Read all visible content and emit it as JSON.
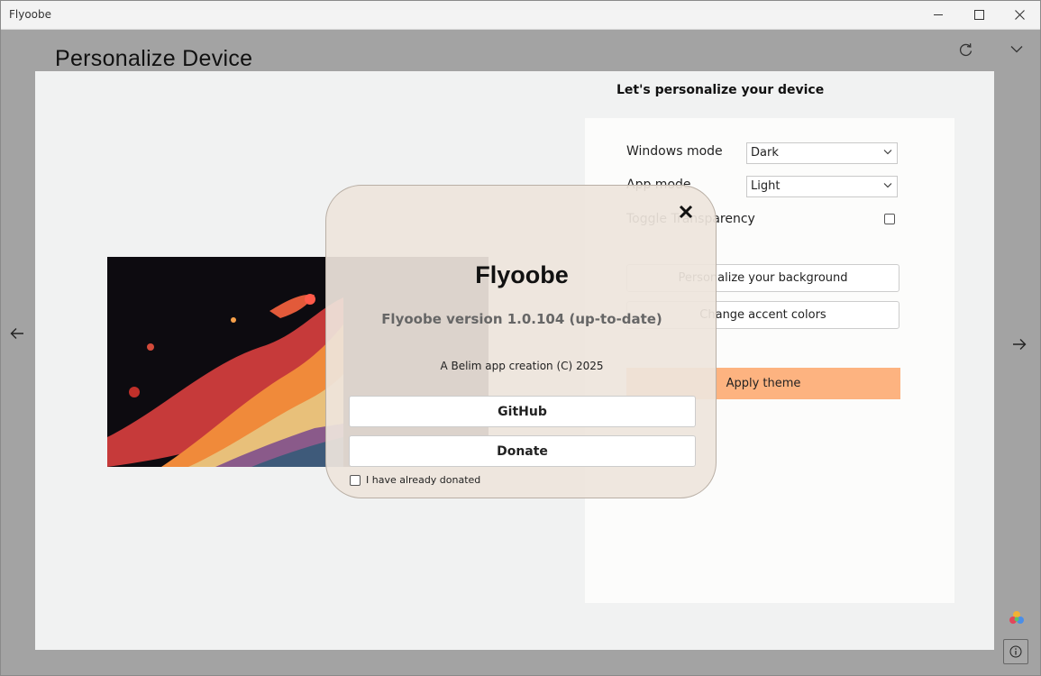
{
  "window": {
    "title": "Flyoobe"
  },
  "page": {
    "title": "Personalize Device"
  },
  "panel": {
    "heading": "Let's personalize your device",
    "windows_mode": {
      "label": "Windows mode",
      "value": "Dark"
    },
    "app_mode": {
      "label": "App mode",
      "value": "Light"
    },
    "transparency": {
      "label": "Toggle Transparency",
      "checked": false
    },
    "background_button": "Personalize your background",
    "accent_button": "Change accent colors",
    "apply_button": "Apply theme",
    "apply_color": "#fdb380"
  },
  "dialog": {
    "title": "Flyoobe",
    "version": "Flyoobe version 1.0.104 (up-to-date)",
    "credit": "A Belim app creation (C) 2025",
    "github_button": "GitHub",
    "donate_button": "Donate",
    "donated_checkbox_label": "I have already donated"
  },
  "icons": [
    "refresh-icon",
    "chevron-down-icon",
    "arrow-left-icon",
    "arrow-right-icon",
    "palette-icon",
    "info-icon",
    "close-icon"
  ]
}
